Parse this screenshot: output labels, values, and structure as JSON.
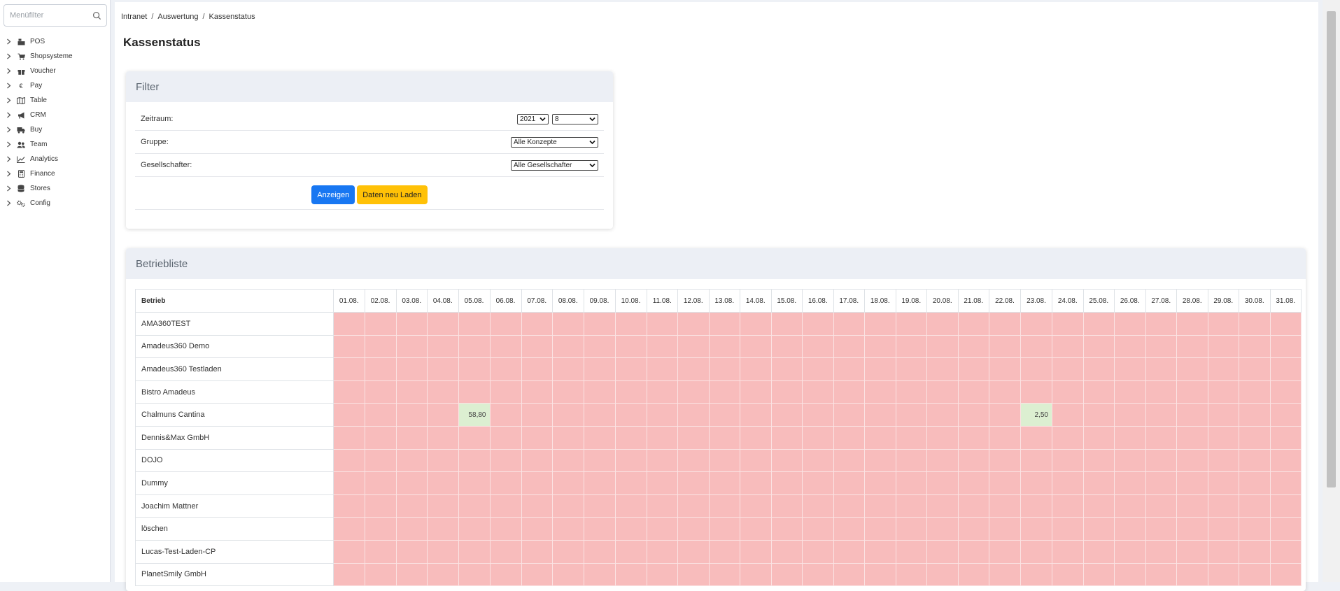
{
  "sidebar": {
    "filter_placeholder": "Menüfilter",
    "items": [
      {
        "label": "POS",
        "icon": "cash-register-icon"
      },
      {
        "label": "Shopsysteme",
        "icon": "shopping-cart-icon"
      },
      {
        "label": "Voucher",
        "icon": "gift-icon"
      },
      {
        "label": "Pay",
        "icon": "euro-icon"
      },
      {
        "label": "Table",
        "icon": "table-map-icon"
      },
      {
        "label": "CRM",
        "icon": "megaphone-icon"
      },
      {
        "label": "Buy",
        "icon": "truck-icon"
      },
      {
        "label": "Team",
        "icon": "users-icon"
      },
      {
        "label": "Analytics",
        "icon": "chart-line-icon"
      },
      {
        "label": "Finance",
        "icon": "calculator-icon"
      },
      {
        "label": "Stores",
        "icon": "database-icon"
      },
      {
        "label": "Config",
        "icon": "cogs-icon"
      }
    ]
  },
  "breadcrumb": [
    "Intranet",
    "Auswertung",
    "Kassenstatus"
  ],
  "page_title": "Kassenstatus",
  "filter": {
    "title": "Filter",
    "zeitraum_label": "Zeitraum:",
    "year_value": "2021",
    "month_value": "8",
    "gruppe_label": "Gruppe:",
    "gruppe_value": "Alle Konzepte",
    "gesellschafter_label": "Gesellschafter:",
    "gesellschafter_value": "Alle Gesellschafter",
    "show_button": "Anzeigen",
    "reload_button": "Daten neu Laden"
  },
  "betriebliste": {
    "title": "Betriebliste",
    "name_header": "Betrieb",
    "days": [
      "01.08.",
      "02.08.",
      "03.08.",
      "04.08.",
      "05.08.",
      "06.08.",
      "07.08.",
      "08.08.",
      "09.08.",
      "10.08.",
      "11.08.",
      "12.08.",
      "13.08.",
      "14.08.",
      "15.08.",
      "16.08.",
      "17.08.",
      "18.08.",
      "19.08.",
      "20.08.",
      "21.08.",
      "22.08.",
      "23.08.",
      "24.08.",
      "25.08.",
      "26.08.",
      "27.08.",
      "28.08.",
      "29.08.",
      "30.08.",
      "31.08."
    ],
    "rows": [
      {
        "name": "AMA360TEST",
        "values": {}
      },
      {
        "name": "Amadeus360 Demo",
        "values": {}
      },
      {
        "name": "Amadeus360 Testladen",
        "values": {}
      },
      {
        "name": "Bistro Amadeus",
        "values": {}
      },
      {
        "name": "Chalmuns Cantina",
        "values": {
          "4": "58,80",
          "22": "2,50"
        }
      },
      {
        "name": "Dennis&Max GmbH",
        "values": {}
      },
      {
        "name": "DOJO",
        "values": {}
      },
      {
        "name": "Dummy",
        "values": {}
      },
      {
        "name": "Joachim Mattner",
        "values": {}
      },
      {
        "name": "löschen",
        "values": {}
      },
      {
        "name": "Lucas-Test-Laden-CP",
        "values": {}
      },
      {
        "name": "PlanetSmily GmbH",
        "values": {}
      }
    ]
  },
  "colors": {
    "missing": "#f8bcbc",
    "present": "#dcefd1",
    "primary": "#1877f2",
    "warning": "#ffc107"
  }
}
